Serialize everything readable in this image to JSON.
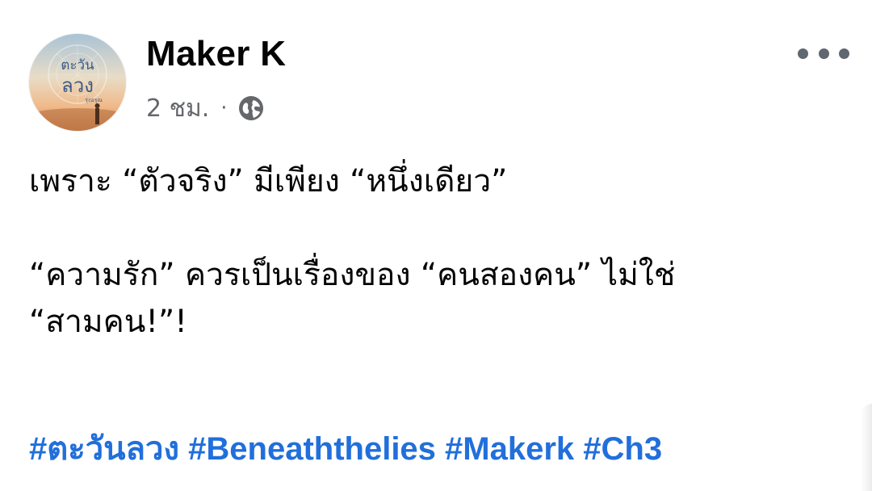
{
  "post": {
    "author": "Maker K",
    "avatar": {
      "title_lines": [
        "ตะวัน",
        "ลวง"
      ],
      "caption": "รุ่งอรุณ",
      "icon": "avatar-book-cover"
    },
    "timestamp": "2 ชม.",
    "separator": "·",
    "audience_icon": "globe-icon",
    "more_icon": "more-options-icon",
    "body_lines": [
      "เพราะ “ตัวจริง” มีเพียง “หนึ่งเดียว”",
      "",
      "“ความรัก” ควรเป็นเรื่องของ “คนสองคน” ไม่ใช่",
      "“สามคน!”!"
    ],
    "hashtags": [
      "#ตะวันลวง",
      "#Beneaththelies",
      "#Makerk",
      "#Ch3"
    ]
  },
  "colors": {
    "text": "#050505",
    "meta": "#65676b",
    "link": "#216fdb",
    "icon": "#606770"
  }
}
